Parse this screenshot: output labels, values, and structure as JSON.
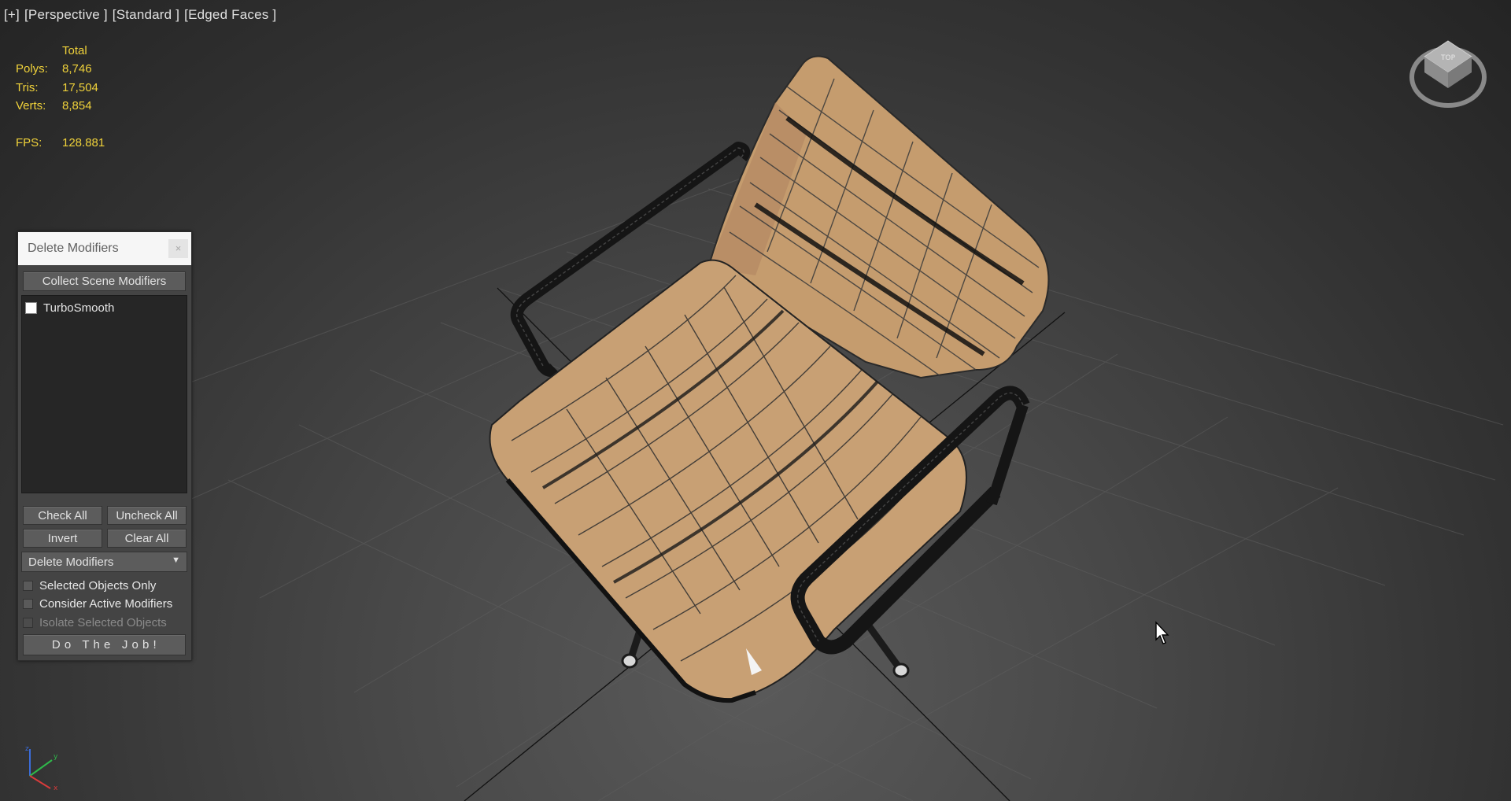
{
  "viewport": {
    "label_parts": [
      "[+]",
      "[Perspective ]",
      "[Standard ]",
      "[Edged Faces ]"
    ]
  },
  "stats": {
    "total_header": "Total",
    "rows": [
      {
        "label": "Polys:",
        "value": "8,746"
      },
      {
        "label": "Tris:",
        "value": "17,504"
      },
      {
        "label": "Verts:",
        "value": "8,854"
      }
    ],
    "fps_label": "FPS:",
    "fps_value": "128.881"
  },
  "panel": {
    "title": "Delete Modifiers",
    "close_label": "×",
    "collect_button": "Collect Scene Modifiers",
    "modifiers": [
      {
        "name": "TurboSmooth",
        "checked": false
      }
    ],
    "check_all": "Check All",
    "uncheck_all": "Uncheck All",
    "invert": "Invert",
    "clear_all": "Clear All",
    "mode_selected": "Delete Modifiers",
    "options": {
      "selected_only": "Selected Objects Only",
      "consider_active": "Consider Active Modifiers",
      "isolate_selected": "Isolate Selected Objects"
    },
    "run_button": "D o   T h e   J o b !"
  },
  "icons": {
    "navcube": "viewcube-icon",
    "axis": "axis-tripod-icon",
    "cursor": "mouse-pointer-icon",
    "dropdown_arrow": "triangle-down-icon"
  },
  "colors": {
    "stats_text": "#f0d23a",
    "chair_fabric": "#c49a6c",
    "chair_frame": "#1a1a1a",
    "panel_bg": "#444444"
  }
}
